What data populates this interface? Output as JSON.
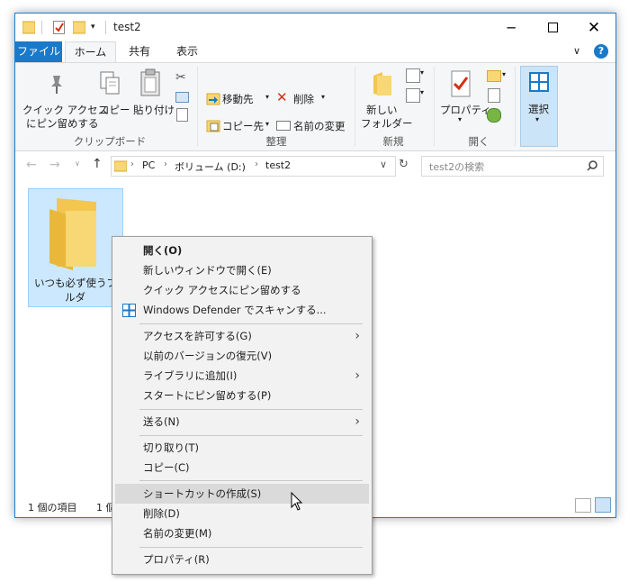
{
  "window": {
    "title": "test2"
  },
  "tabs": [
    "ファイル",
    "ホーム",
    "共有",
    "表示"
  ],
  "ribbon": {
    "clipboard": {
      "pin_line1": "クイック アクセス",
      "pin_line2": "にピン留めする",
      "copy": "コピー",
      "paste": "貼り付け",
      "group": "クリップボード"
    },
    "organize": {
      "move": "移動先",
      "copyto": "コピー先",
      "delete": "削除",
      "rename": "名前の変更",
      "group": "整理"
    },
    "new": {
      "folder_line1": "新しい",
      "folder_line2": "フォルダー",
      "group": "新規"
    },
    "open": {
      "properties": "プロパティ",
      "group": "開く"
    },
    "select": {
      "label": "選択"
    }
  },
  "address": {
    "path": [
      "PC",
      "ボリューム (D:)",
      "test2"
    ],
    "search_placeholder": "test2の検索"
  },
  "folder": {
    "name_line1": "いつも必ず使うフォ",
    "name_line2": "ルダ"
  },
  "status": {
    "items": "1 個の項目",
    "selected": "1 個"
  },
  "context_menu": [
    {
      "label": "開く(O)",
      "bold": true
    },
    {
      "label": "新しいウィンドウで開く(E)"
    },
    {
      "label": "クイック アクセスにピン留めする"
    },
    {
      "label": "Windows Defender でスキャンする..."
    },
    {
      "label": "アクセスを許可する(G)"
    },
    {
      "label": "以前のバージョンの復元(V)"
    },
    {
      "label": "ライブラリに追加(I)"
    },
    {
      "label": "スタートにピン留めする(P)"
    },
    {
      "label": "送る(N)"
    },
    {
      "label": "切り取り(T)"
    },
    {
      "label": "コピー(C)"
    },
    {
      "label": "ショートカットの作成(S)"
    },
    {
      "label": "削除(D)"
    },
    {
      "label": "名前の変更(M)"
    },
    {
      "label": "プロパティ(R)"
    }
  ],
  "colors": {
    "accent": "#1979ca",
    "selection": "#cce8ff",
    "folder": "#f8d775"
  }
}
